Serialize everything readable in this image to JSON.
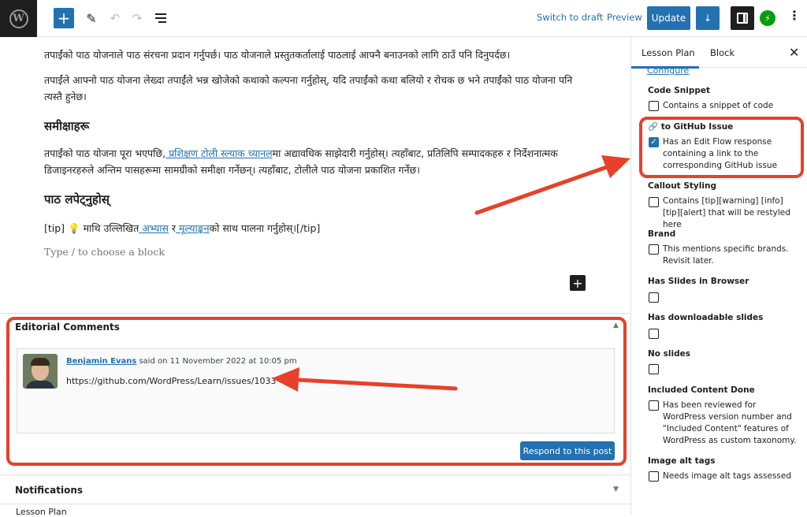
{
  "topbar": {
    "add_icon": "+",
    "pen_icon": "✎",
    "undo_icon": "↶",
    "redo_icon": "↷",
    "switch_to_draft": "Switch to draft",
    "preview": "Preview",
    "update": "Update",
    "down_icon": "↓",
    "jetpack_icon": "⚡",
    "more_icon": "⋮"
  },
  "content": {
    "p1": "तपाईंको पाठ योजनाले पाठ संरचना प्रदान गर्नुपर्छ। पाठ योजनाले प्रस्तुतकर्तालाई पाठलाई आफ्नै बनाउनको लागि ठाउँ पनि दिनुपर्दछ।",
    "p2": "तपाईंले आफ्नो पाठ योजना लेख्दा तपाईंले भन्न खोजेको कथाको कल्पना गर्नुहोस्, यदि तपाईंको कथा बलियो र रोचक छ भने तपाईंको पाठ योजना पनि त्यस्तै हुनेछ।",
    "h1": "समीक्षाहरू",
    "p3_before": "तपाईंको पाठ योजना पूरा भएपछि,",
    "p3_link": " प्रशिक्षण टोली स्ल्याक च्यानल",
    "p3_after": "मा अद्यावधिक साझेदारी गर्नुहोस्। त्यहाँबाट, प्रतिलिपि सम्पादकहरु र निर्देशनात्मक डिजाइनरहरुले अन्तिम पासहरूमा सामग्रीको समीक्षा गर्नेछन्। त्यहाँबाट, टोलीले पाठ योजना प्रकाशित गर्नेछ।",
    "h2": "पाठ लपेट्नुहोस्",
    "tip_before": "[tip] 💡 माथि उल्लिखित",
    "tip_link1": " अभ्यास",
    "tip_mid": " र",
    "tip_link2": " मूल्याङ्कन",
    "tip_after": "को साथ पालना गर्नुहोस्।[/tip]",
    "placeholder": "Type / to choose a block",
    "inline_plus": "+"
  },
  "editorial": {
    "title": "Editorial Comments",
    "caret": "▲",
    "author": "Benjamin Evans",
    "said_on": "said on 11 November 2022 at 10:05 pm",
    "link": "https://github.com/WordPress/Learn/issues/1033",
    "respond": "Respond to this post"
  },
  "notifications": {
    "title": "Notifications",
    "caret": "▼"
  },
  "bottom_label": "Lesson Plan",
  "sidebar": {
    "tab_lesson_plan": "Lesson Plan",
    "tab_block": "Block",
    "close": "✕",
    "configure": "Configure",
    "groups": [
      {
        "title": "Code Snippet",
        "label": "Contains a snippet of code",
        "checked": false
      },
      {
        "title": "🔗 to GitHub Issue",
        "label": "Has an Edit Flow response containing a link to the corresponding GitHub issue",
        "checked": true
      },
      {
        "title": "Callout Styling",
        "label": "Contains [tip][warning] [info] [tip][alert] that will be restyled here",
        "checked": false
      },
      {
        "title": "Brand",
        "label": "This mentions specific brands. Revisit later.",
        "checked": false
      },
      {
        "title": "Has Slides in Browser",
        "label": "",
        "checked": false
      },
      {
        "title": "Has downloadable slides",
        "label": "",
        "checked": false
      },
      {
        "title": "No slides",
        "label": "",
        "checked": false
      },
      {
        "title": "Included Content Done",
        "label": "Has been reviewed for WordPress version number and \"Included Content\" features of WordPress as custom taxonomy.",
        "checked": false
      },
      {
        "title": "Image alt tags",
        "label": "Needs image alt tags assessed",
        "checked": false
      }
    ]
  },
  "colors": {
    "accent": "#2271b1",
    "annotation": "#e8402a",
    "dark": "#1e1e1e",
    "jetpack": "#069e08"
  }
}
